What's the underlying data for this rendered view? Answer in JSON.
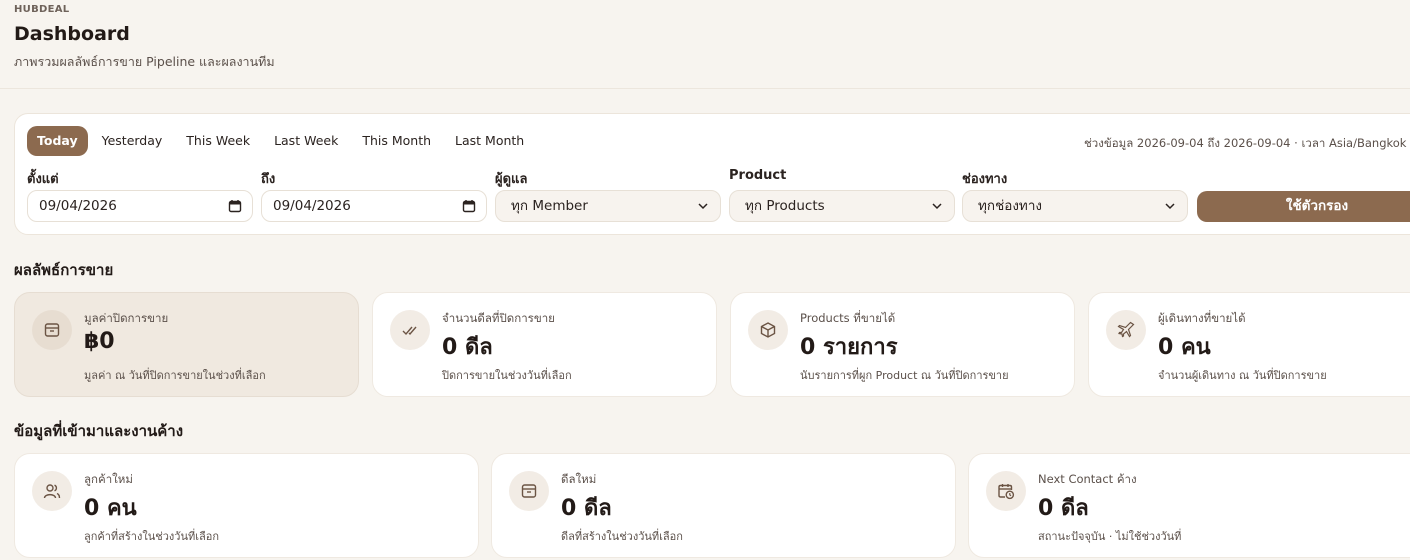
{
  "header": {
    "brand": "HUBDEAL",
    "title": "Dashboard",
    "subtitle": "ภาพรวมผลลัพธ์การขาย Pipeline และผลงานทีม"
  },
  "filters": {
    "quick_ranges": [
      "Today",
      "Yesterday",
      "This Week",
      "Last Week",
      "This Month",
      "Last Month"
    ],
    "active_range": "Today",
    "range_info": "ช่วงข้อมูล 2026-09-04 ถึง 2026-09-04 · เวลา Asia/Bangkok",
    "from_label": "ตั้งแต่",
    "from_value": "09/04/2026",
    "to_label": "ถึง",
    "to_value": "09/04/2026",
    "owner_label": "ผู้ดูแล",
    "owner_value": "ทุก Member",
    "product_label": "Product",
    "product_value": "ทุก Products",
    "channel_label": "ช่องทาง",
    "channel_value": "ทุกช่องทาง",
    "apply_label": "ใช้ตัวกรอง"
  },
  "sales_section": {
    "title": "ผลลัพธ์การขาย",
    "cards": [
      {
        "label": "มูลค่าปิดการขาย",
        "value": "฿0",
        "sub": "มูลค่า ณ วันที่ปิดการขายในช่วงที่เลือก",
        "icon": "box-icon"
      },
      {
        "label": "จำนวนดีลที่ปิดการขาย",
        "value": "0 ดีล",
        "sub": "ปิดการขายในช่วงวันที่เลือก",
        "icon": "double-check-icon"
      },
      {
        "label": "Products ที่ขายได้",
        "value": "0 รายการ",
        "sub": "นับรายการที่ผูก Product ณ วันที่ปิดการขาย",
        "icon": "package-icon"
      },
      {
        "label": "ผู้เดินทางที่ขายได้",
        "value": "0 คน",
        "sub": "จำนวนผู้เดินทาง ณ วันที่ปิดการขาย",
        "icon": "plane-icon"
      }
    ]
  },
  "incoming_section": {
    "title": "ข้อมูลที่เข้ามาและงานค้าง",
    "cards": [
      {
        "label": "ลูกค้าใหม่",
        "value": "0 คน",
        "sub": "ลูกค้าที่สร้างในช่วงวันที่เลือก",
        "icon": "users-icon"
      },
      {
        "label": "ดีลใหม่",
        "value": "0 ดีล",
        "sub": "ดีลที่สร้างในช่วงวันที่เลือก",
        "icon": "box-icon"
      },
      {
        "label": "Next Contact ค้าง",
        "value": "0 ดีล",
        "sub": "สถานะปัจจุบัน · ไม่ใช้ช่วงวันที่",
        "icon": "calendar-clock-icon"
      }
    ]
  }
}
